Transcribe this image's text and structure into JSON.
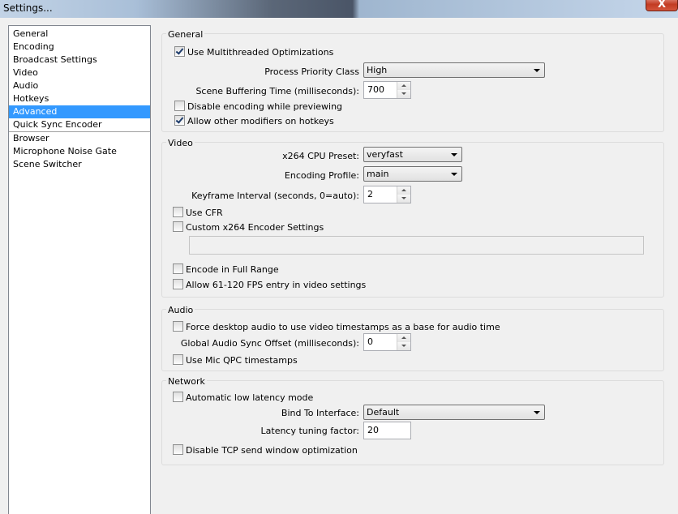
{
  "window": {
    "title": "Settings...",
    "close_glyph": "X"
  },
  "sidebar": {
    "items": [
      {
        "label": "General"
      },
      {
        "label": "Encoding"
      },
      {
        "label": "Broadcast Settings"
      },
      {
        "label": "Video"
      },
      {
        "label": "Audio"
      },
      {
        "label": "Hotkeys"
      },
      {
        "label": "Advanced",
        "selected": true
      },
      {
        "label": "Quick Sync Encoder"
      },
      {
        "label": "Browser"
      },
      {
        "label": "Microphone Noise Gate"
      },
      {
        "label": "Scene Switcher"
      }
    ]
  },
  "general": {
    "title": "General",
    "multithreaded": {
      "label": "Use Multithreaded Optimizations",
      "checked": true
    },
    "priority": {
      "label": "Process Priority Class",
      "value": "High"
    },
    "buffering": {
      "label": "Scene Buffering Time (milliseconds):",
      "value": "700"
    },
    "disable_preview": {
      "label": "Disable encoding while previewing",
      "checked": false
    },
    "modifiers": {
      "label": "Allow other modifiers on hotkeys",
      "checked": true
    }
  },
  "video": {
    "title": "Video",
    "preset": {
      "label": "x264 CPU Preset:",
      "value": "veryfast"
    },
    "profile": {
      "label": "Encoding Profile:",
      "value": "main"
    },
    "keyframe": {
      "label": "Keyframe Interval (seconds, 0=auto):",
      "value": "2"
    },
    "cfr": {
      "label": "Use CFR",
      "checked": false
    },
    "custom_x264": {
      "label": "Custom x264 Encoder Settings",
      "checked": false,
      "value": ""
    },
    "full_range": {
      "label": "Encode in Full Range",
      "checked": false
    },
    "high_fps": {
      "label": "Allow 61-120 FPS entry in video settings",
      "checked": false
    }
  },
  "audio": {
    "title": "Audio",
    "force_desktop": {
      "label": "Force desktop audio to use video timestamps as a base for audio time",
      "checked": false
    },
    "sync_offset": {
      "label": "Global Audio Sync Offset (milliseconds):",
      "value": "0"
    },
    "mic_qpc": {
      "label": "Use Mic QPC timestamps",
      "checked": false
    }
  },
  "network": {
    "title": "Network",
    "low_latency": {
      "label": "Automatic low latency mode",
      "checked": false
    },
    "bind": {
      "label": "Bind To Interface:",
      "value": "Default"
    },
    "latency_factor": {
      "label": "Latency tuning factor:",
      "value": "20"
    },
    "disable_tcp": {
      "label": "Disable TCP send window optimization",
      "checked": false
    }
  }
}
